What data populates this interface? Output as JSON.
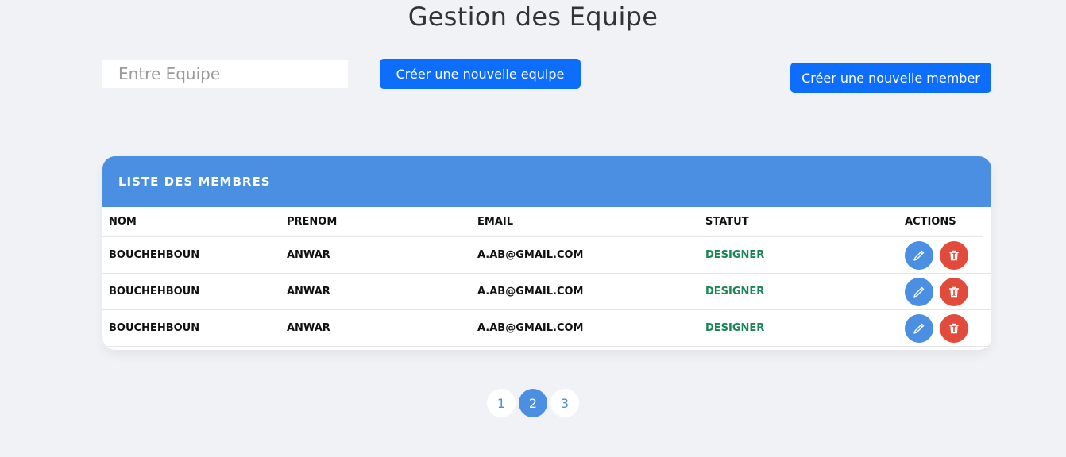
{
  "header": {
    "title": "Gestion des Equipe"
  },
  "toolbar": {
    "team_input_placeholder": "Entre Equipe",
    "team_input_value": "",
    "create_team_label": "Créer une nouvelle equipe",
    "create_member_label": "Créer une nouvelle member"
  },
  "members_card": {
    "title": "LISTE DES MEMBRES",
    "columns": [
      "NOM",
      "PRENOM",
      "EMAIL",
      "STATUT",
      "ACTIONS"
    ],
    "rows": [
      {
        "nom": "BOUCHEHBOUN",
        "prenom": "ANWAR",
        "email": "A.AB@GMAIL.COM",
        "statut": "DESIGNER"
      },
      {
        "nom": "BOUCHEHBOUN",
        "prenom": "ANWAR",
        "email": "A.AB@GMAIL.COM",
        "statut": "DESIGNER"
      },
      {
        "nom": "BOUCHEHBOUN",
        "prenom": "ANWAR",
        "email": "A.AB@GMAIL.COM",
        "statut": "DESIGNER"
      }
    ],
    "actions": {
      "edit_icon": "pencil-icon",
      "delete_icon": "trash-icon"
    }
  },
  "pagination": {
    "pages": [
      "1",
      "2",
      "3"
    ],
    "current": "2"
  },
  "colors": {
    "primary_button": "#0d6efd",
    "card_header": "#4a8fe1",
    "status_text": "#198754",
    "delete_button": "#e24b3b",
    "background": "#f0f2f5"
  }
}
